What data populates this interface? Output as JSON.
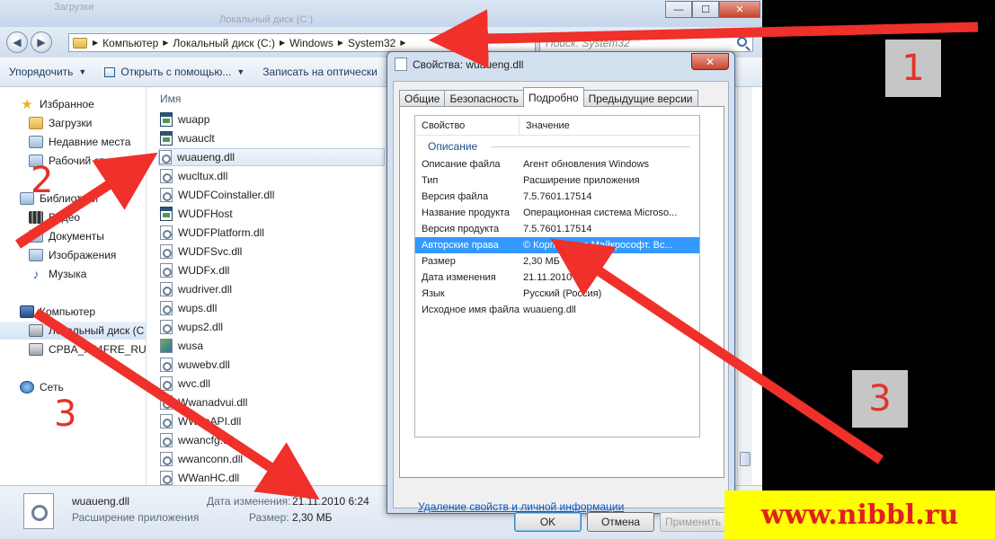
{
  "explorer": {
    "ghost_titles": [
      "Загрузки",
      "Локальный диск (C:)"
    ],
    "caption": {
      "minimize": "—",
      "maximize": "☐",
      "close": "✕"
    },
    "address": {
      "crumbs": [
        "Компьютер",
        "Локальный диск (C:)",
        "Windows",
        "System32"
      ]
    },
    "search": {
      "placeholder": "Поиск: System32"
    },
    "toolbar": {
      "organize": "Упорядочить",
      "open_with": "Открыть с помощью...",
      "burn": "Записать на оптически"
    },
    "nav": {
      "favorites": "Избранное",
      "downloads": "Загрузки",
      "recent": "Недавние места",
      "desktop": "Рабочий стол",
      "libraries": "Библиотеки",
      "video": "Видео",
      "documents": "Документы",
      "pictures": "Изображения",
      "music": "Музыка",
      "computer": "Компьютер",
      "local_disk": "Локальный диск (C",
      "dvd": "CPBA_X64FRE_RU-R",
      "network": "Сеть"
    },
    "files": {
      "column_name": "Имя",
      "items": [
        {
          "name": "wuapp",
          "type": "exe"
        },
        {
          "name": "wuauclt",
          "type": "exe"
        },
        {
          "name": "wuaueng.dll",
          "type": "dll"
        },
        {
          "name": "wucltux.dll",
          "type": "dll"
        },
        {
          "name": "WUDFCoinstaller.dll",
          "type": "dll"
        },
        {
          "name": "WUDFHost",
          "type": "exe"
        },
        {
          "name": "WUDFPlatform.dll",
          "type": "dll"
        },
        {
          "name": "WUDFSvc.dll",
          "type": "dll"
        },
        {
          "name": "WUDFx.dll",
          "type": "dll"
        },
        {
          "name": "wudriver.dll",
          "type": "dll"
        },
        {
          "name": "wups.dll",
          "type": "dll"
        },
        {
          "name": "wups2.dll",
          "type": "dll"
        },
        {
          "name": "wusa",
          "type": "img"
        },
        {
          "name": "wuwebv.dll",
          "type": "dll"
        },
        {
          "name": "wvc.dll",
          "type": "dll"
        },
        {
          "name": "Wwanadvui.dll",
          "type": "dll"
        },
        {
          "name": "WWanAPI.dll",
          "type": "dll"
        },
        {
          "name": "wwancfg.dll",
          "type": "dll"
        },
        {
          "name": "wwanconn.dll",
          "type": "dll"
        },
        {
          "name": "WWanHC.dll",
          "type": "dll"
        }
      ],
      "selected_index": 2
    },
    "status": {
      "file_name": "wuaueng.dll",
      "file_type": "Расширение приложения",
      "modified_label": "Дата изменения:",
      "modified_value": "21.11.2010 6:24",
      "size_label": "Размер:",
      "size_value": "2,30 МБ"
    }
  },
  "dialog": {
    "title": "Свойства: wuaueng.dll",
    "close": "✕",
    "tabs": [
      "Общие",
      "Безопасность",
      "Подробно",
      "Предыдущие версии"
    ],
    "active_tab": 2,
    "columns": {
      "property": "Свойство",
      "value": "Значение"
    },
    "group": "Описание",
    "rows": [
      {
        "k": "Описание файла",
        "v": "Агент обновления Windows"
      },
      {
        "k": "Тип",
        "v": "Расширение приложения"
      },
      {
        "k": "Версия файла",
        "v": "7.5.7601.17514"
      },
      {
        "k": "Название продукта",
        "v": "Операционная система Microso..."
      },
      {
        "k": "Версия продукта",
        "v": "7.5.7601.17514"
      },
      {
        "k": "Авторские права",
        "v": "© Корпорация Майкрософт. Вс..."
      },
      {
        "k": "Размер",
        "v": "2,30 МБ"
      },
      {
        "k": "Дата изменения",
        "v": "21.11.2010 6:24"
      },
      {
        "k": "Язык",
        "v": "Русский (Россия)"
      },
      {
        "k": "Исходное имя файла",
        "v": "wuaueng.dll"
      }
    ],
    "selected_row": 5,
    "remove_link": "Удаление свойств и личной информации",
    "buttons": {
      "ok": "OK",
      "cancel": "Отмена",
      "apply": "Применить"
    }
  },
  "annotations": {
    "labels": [
      "1",
      "2",
      "3",
      "3"
    ],
    "arrow_color": "#f0302a",
    "watermark": "www.nibbl.ru"
  }
}
